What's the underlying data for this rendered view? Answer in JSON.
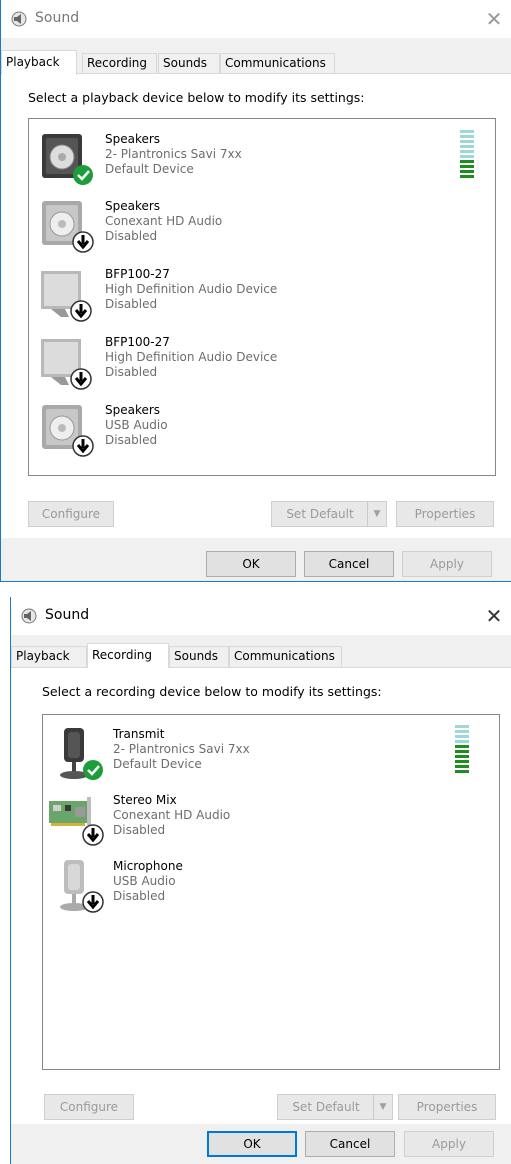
{
  "dialogs": [
    {
      "title": "Sound",
      "close_glyph": "✕",
      "tabs": [
        "Playback",
        "Recording",
        "Sounds",
        "Communications"
      ],
      "active_tab": "Playback",
      "instruction": "Select a playback device below to modify its settings:",
      "devices": [
        {
          "name": "Speakers",
          "line2": "2- Plantronics Savi 7xx",
          "line3": "Default Device",
          "icon": "speaker-icon",
          "badge": "default-check-icon",
          "level_bars": 10,
          "level_active": 4
        },
        {
          "name": "Speakers",
          "line2": "Conexant HD Audio",
          "line3": "Disabled",
          "icon": "speaker-icon",
          "badge": "disabled-arrow-icon"
        },
        {
          "name": "BFP100-27",
          "line2": "High Definition Audio Device",
          "line3": "Disabled",
          "icon": "monitor-icon",
          "badge": "disabled-arrow-icon"
        },
        {
          "name": "BFP100-27",
          "line2": "High Definition Audio Device",
          "line3": "Disabled",
          "icon": "monitor-icon",
          "badge": "disabled-arrow-icon"
        },
        {
          "name": "Speakers",
          "line2": "USB Audio",
          "line3": "Disabled",
          "icon": "speaker-icon",
          "badge": "disabled-arrow-icon"
        }
      ],
      "buttons": {
        "configure": "Configure",
        "set_default": "Set Default",
        "properties": "Properties",
        "ok": "OK",
        "cancel": "Cancel",
        "apply": "Apply"
      }
    },
    {
      "title": "Sound",
      "close_glyph": "✕",
      "tabs": [
        "Playback",
        "Recording",
        "Sounds",
        "Communications"
      ],
      "active_tab": "Recording",
      "instruction": "Select a recording device below to modify its settings:",
      "devices": [
        {
          "name": "Transmit",
          "line2": "2- Plantronics Savi 7xx",
          "line3": "Default Device",
          "icon": "microphone-icon",
          "badge": "default-check-icon",
          "level_bars": 10,
          "level_active": 6
        },
        {
          "name": "Stereo Mix",
          "line2": "Conexant HD Audio",
          "line3": "Disabled",
          "icon": "sound-card-icon",
          "badge": "disabled-arrow-icon"
        },
        {
          "name": "Microphone",
          "line2": "USB Audio",
          "line3": "Disabled",
          "icon": "microphone-icon",
          "badge": "disabled-arrow-icon"
        }
      ],
      "buttons": {
        "configure": "Configure",
        "set_default": "Set Default",
        "properties": "Properties",
        "ok": "OK",
        "cancel": "Cancel",
        "apply": "Apply"
      }
    }
  ],
  "colors": {
    "accent_border": "#1979ca",
    "level_active": "#1e8f1e",
    "level_inactive": "#9fd7d7",
    "check_badge": "#1b9e3a"
  }
}
